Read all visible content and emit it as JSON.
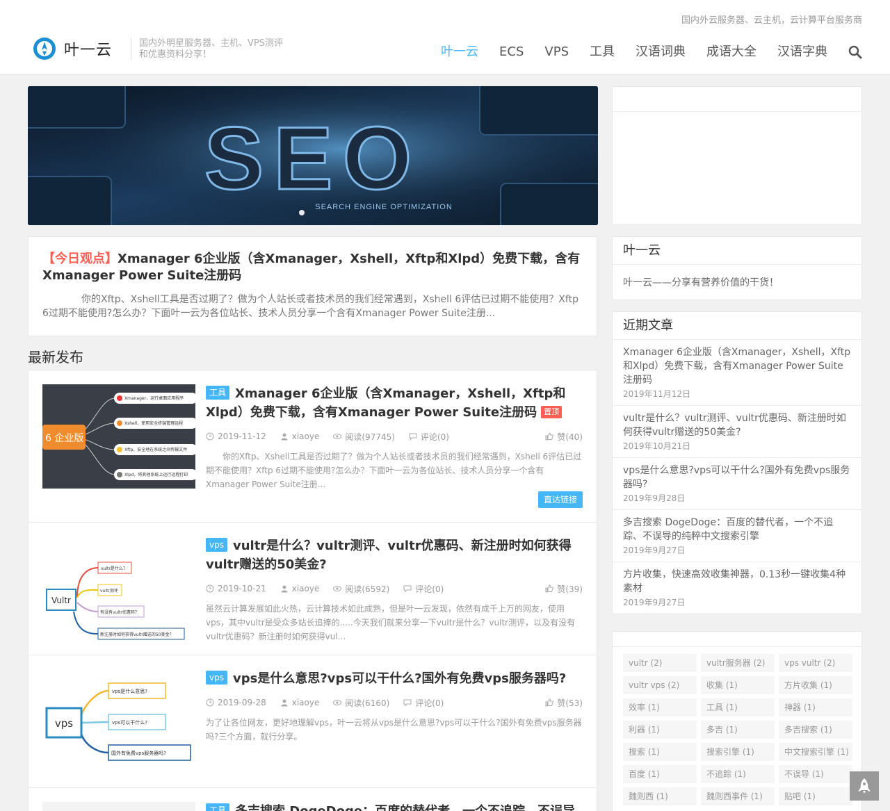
{
  "header": {
    "top_slogan": "国内外云服务器、云主机，云计算平台服务商",
    "site_name": "叶一云",
    "site_desc": "国内外明星服务器、主机、VPS测评和优惠资料分享！",
    "nav": [
      "叶一云",
      "ECS",
      "VPS",
      "工具",
      "汉语词典",
      "成语大全",
      "汉语字典"
    ],
    "active_nav": "叶一云"
  },
  "banner": {
    "big_text": "SEO",
    "caption": "SEARCH ENGINE OPTIMIZATION"
  },
  "sticky": {
    "tag": "【今日观点】",
    "title": "Xmanager 6企业版（含Xmanager，Xshell，Xftp和Xlpd）免费下载，含有Xmanager Power Suite注册码",
    "excerpt": "你的Xftp、Xshell工具是否过期了？做为个人站长或者技术员的我们经常遇到，Xshell 6评估已过期不能使用？Xftp 6过期不能使用?怎么办？下面叶一云为各位站长、技术人员分享一个含有Xmanager Power Suite注册..."
  },
  "section_title": "最新发布",
  "posts": [
    {
      "category": "工具",
      "title": "Xmanager 6企业版（含Xmanager，Xshell，Xftp和Xlpd）免费下载，含有Xmanager Power Suite注册码",
      "badge": "置顶",
      "date": "2019-11-12",
      "author": "xiaoye",
      "views": "阅读(97745)",
      "comments": "评论(0)",
      "likes": "赞(40)",
      "excerpt": "你的Xftp、Xshell工具是否过期了？做为个人站长或者技术员的我们经常遇到，Xshell 6评估已过期不能使用？Xftp 6过期不能使用?怎么办？下面叶一云为各位站长、技术人员分享一个含有Xmanager Power Suite注册...",
      "read_more": "直达链接",
      "thumb": {
        "center": "6 企业版",
        "branches": [
          "Xmanager，运行桌面应用程序",
          "Xshell，使用安全终端管理远程",
          "Xftp，安全地在系统之间传输文件",
          "Xlpd，将其他系统上运行远程打印"
        ]
      }
    },
    {
      "category": "vps",
      "title": "vultr是什么？vultr测评、vultr优惠码、新注册时如何获得vultr赠送的50美金?",
      "date": "2019-10-21",
      "author": "xiaoye",
      "views": "阅读(6592)",
      "comments": "评论(0)",
      "likes": "赞(39)",
      "excerpt": "虽然云计算发展如此火热，云计算技术如此成熟，但是叶一云发现，依然有成千上万的网友，使用vps，其中vultr是受众多站长追捧的.....今天我们就来分享一下vultr是什么？vultr测评，以及有没有vultr优惠码？新注册时如何获得vul...",
      "thumb": {
        "center": "Vultr",
        "branches": [
          "vultr是什么？",
          "vultr测评",
          "有没有vultr优惠码？",
          "新注册时如何获得vultr赠送的50美金？"
        ]
      }
    },
    {
      "category": "vps",
      "title": "vps是什么意思?vps可以干什么?国外有免费vps服务器吗?",
      "date": "2019-09-28",
      "author": "xiaoye",
      "views": "阅读(6160)",
      "comments": "评论(0)",
      "likes": "赞(53)",
      "excerpt": "为了让各位网友，更好地理解vps，叶一云将从vps是什么意思?vps可以干什么?国外有免费vps服务器吗?三个方面，就行分享。",
      "thumb": {
        "center": "vps",
        "branches": [
          "vps是什么意思?",
          "vps可以干什么?",
          "国外有免费vps服务器吗?"
        ]
      }
    },
    {
      "category": "工具",
      "title": "多吉搜索 DogeDoge：百度的替代者，一个不追踪、不误导",
      "date": "",
      "author": "",
      "views": "",
      "comments": "",
      "likes": "",
      "excerpt": ""
    }
  ],
  "sidebar": {
    "about": {
      "title": "叶一云",
      "text": "叶一云——分享有营养价值的干货！"
    },
    "recent": {
      "title": "近期文章",
      "items": [
        {
          "title": "Xmanager 6企业版（含Xmanager，Xshell，Xftp和Xlpd）免费下载，含有Xmanager Power Suite注册码",
          "date": "2019年11月12日"
        },
        {
          "title": "vultr是什么？vultr测评、vultr优惠码、新注册时如何获得vultr赠送的50美金?",
          "date": "2019年10月21日"
        },
        {
          "title": "vps是什么意思?vps可以干什么?国外有免费vps服务器吗?",
          "date": "2019年9月28日"
        },
        {
          "title": "多吉搜索 DogeDoge：百度的替代者，一个不追踪、不误导的纯粹中文搜索引擎",
          "date": "2019年9月27日"
        },
        {
          "title": "方片收集，快速高效收集神器，0.13秒一键收集4种素材",
          "date": "2019年9月27日"
        }
      ]
    },
    "tags": [
      "vultr (2)",
      "vultr服务器 (2)",
      "vps vultr (2)",
      "vultr vps (2)",
      "收集 (1)",
      "方片收集 (1)",
      "效率 (1)",
      "工具 (1)",
      "神器 (1)",
      "利器 (1)",
      "多吉 (1)",
      "多吉搜索 (1)",
      "搜索 (1)",
      "搜索引擎 (1)",
      "中文搜索引擎 (1)",
      "百度 (1)",
      "不追踪 (1)",
      "不误导 (1)",
      "魏则西 (1)",
      "魏则西事件 (1)",
      "贴吧 (1)"
    ]
  }
}
